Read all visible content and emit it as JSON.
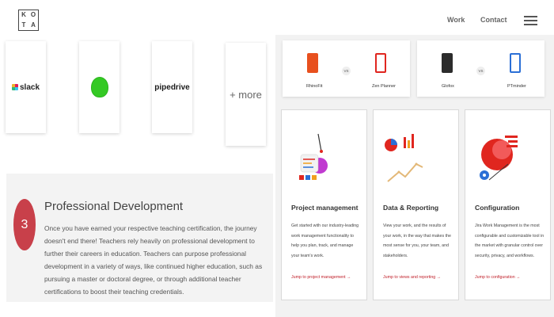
{
  "header": {
    "logo_letters": [
      "K",
      "O",
      "T",
      "A"
    ],
    "nav": {
      "work": "Work",
      "contact": "Contact"
    }
  },
  "integrations": {
    "slack": "slack",
    "pipedrive": "pipedrive",
    "more": "+ more"
  },
  "professional_development": {
    "number": "3",
    "title": "Professional Development",
    "body": "Once you have earned your respective teaching certification, the journey doesn't end there! Teachers rely heavily on professional development to further their careers in education. Teachers can purpose professional development in a variety of ways, like continued higher education, such as pursuing a master or doctoral degree, or through additional teacher certifications to boost their teaching credentials."
  },
  "comparisons": [
    {
      "left": "RhinoFit",
      "vs": "VS",
      "right": "Zen Planner"
    },
    {
      "left": "Glofox",
      "vs": "VS",
      "right": "PTminder"
    }
  ],
  "features": [
    {
      "title": "Project management",
      "body": "Get started with our industry-leading work management functionality to help you plan, track, and manage your team's work.",
      "link": "Jump to project management →"
    },
    {
      "title": "Data & Reporting",
      "body": "View your work, and the results of your work, in the way that makes the most sense for you, your team, and stakeholders.",
      "link": "Jump to views and reporting →"
    },
    {
      "title": "Configuration",
      "body": "Jira Work Management is the most configurable and customizable tool in the market with granular control over security, privacy, and workflows.",
      "link": "Jump to configuration →"
    }
  ],
  "colors": {
    "accent": "#c8404a",
    "link": "#c0202a",
    "rhinofit": "#e8501e",
    "zenplanner": "#e0261f",
    "glofox": "#2c2c2c",
    "ptminder": "#2b6fd6"
  }
}
